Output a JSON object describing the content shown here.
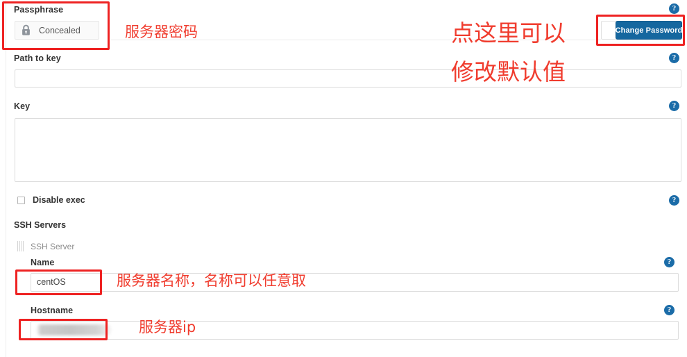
{
  "form": {
    "passphrase": {
      "label": "Passphrase",
      "value": "Concealed",
      "icon": "lock-icon",
      "change_button_label": "Change Password"
    },
    "path_to_key": {
      "label": "Path to key",
      "value": ""
    },
    "key": {
      "label": "Key",
      "value": ""
    },
    "disable_exec": {
      "label": "Disable exec",
      "checked": false
    },
    "ssh_servers": {
      "section_label": "SSH Servers",
      "item_label": "SSH Server",
      "fields": [
        {
          "label": "Name",
          "value": "centOS"
        },
        {
          "label": "Hostname",
          "value": ""
        }
      ]
    },
    "help_icon_glyph": "?"
  },
  "annotations": [
    {
      "text": "服务器密码"
    },
    {
      "text": "点这里可以"
    },
    {
      "text": "修改默认值"
    },
    {
      "text": "服务器名称，名称可以任意取"
    },
    {
      "text": "服务器ip"
    }
  ],
  "colors": {
    "accent_blue": "#15679f",
    "help_blue": "#1b6ca8",
    "annotation_red": "#f03c2e",
    "box_red": "#ee2222"
  }
}
